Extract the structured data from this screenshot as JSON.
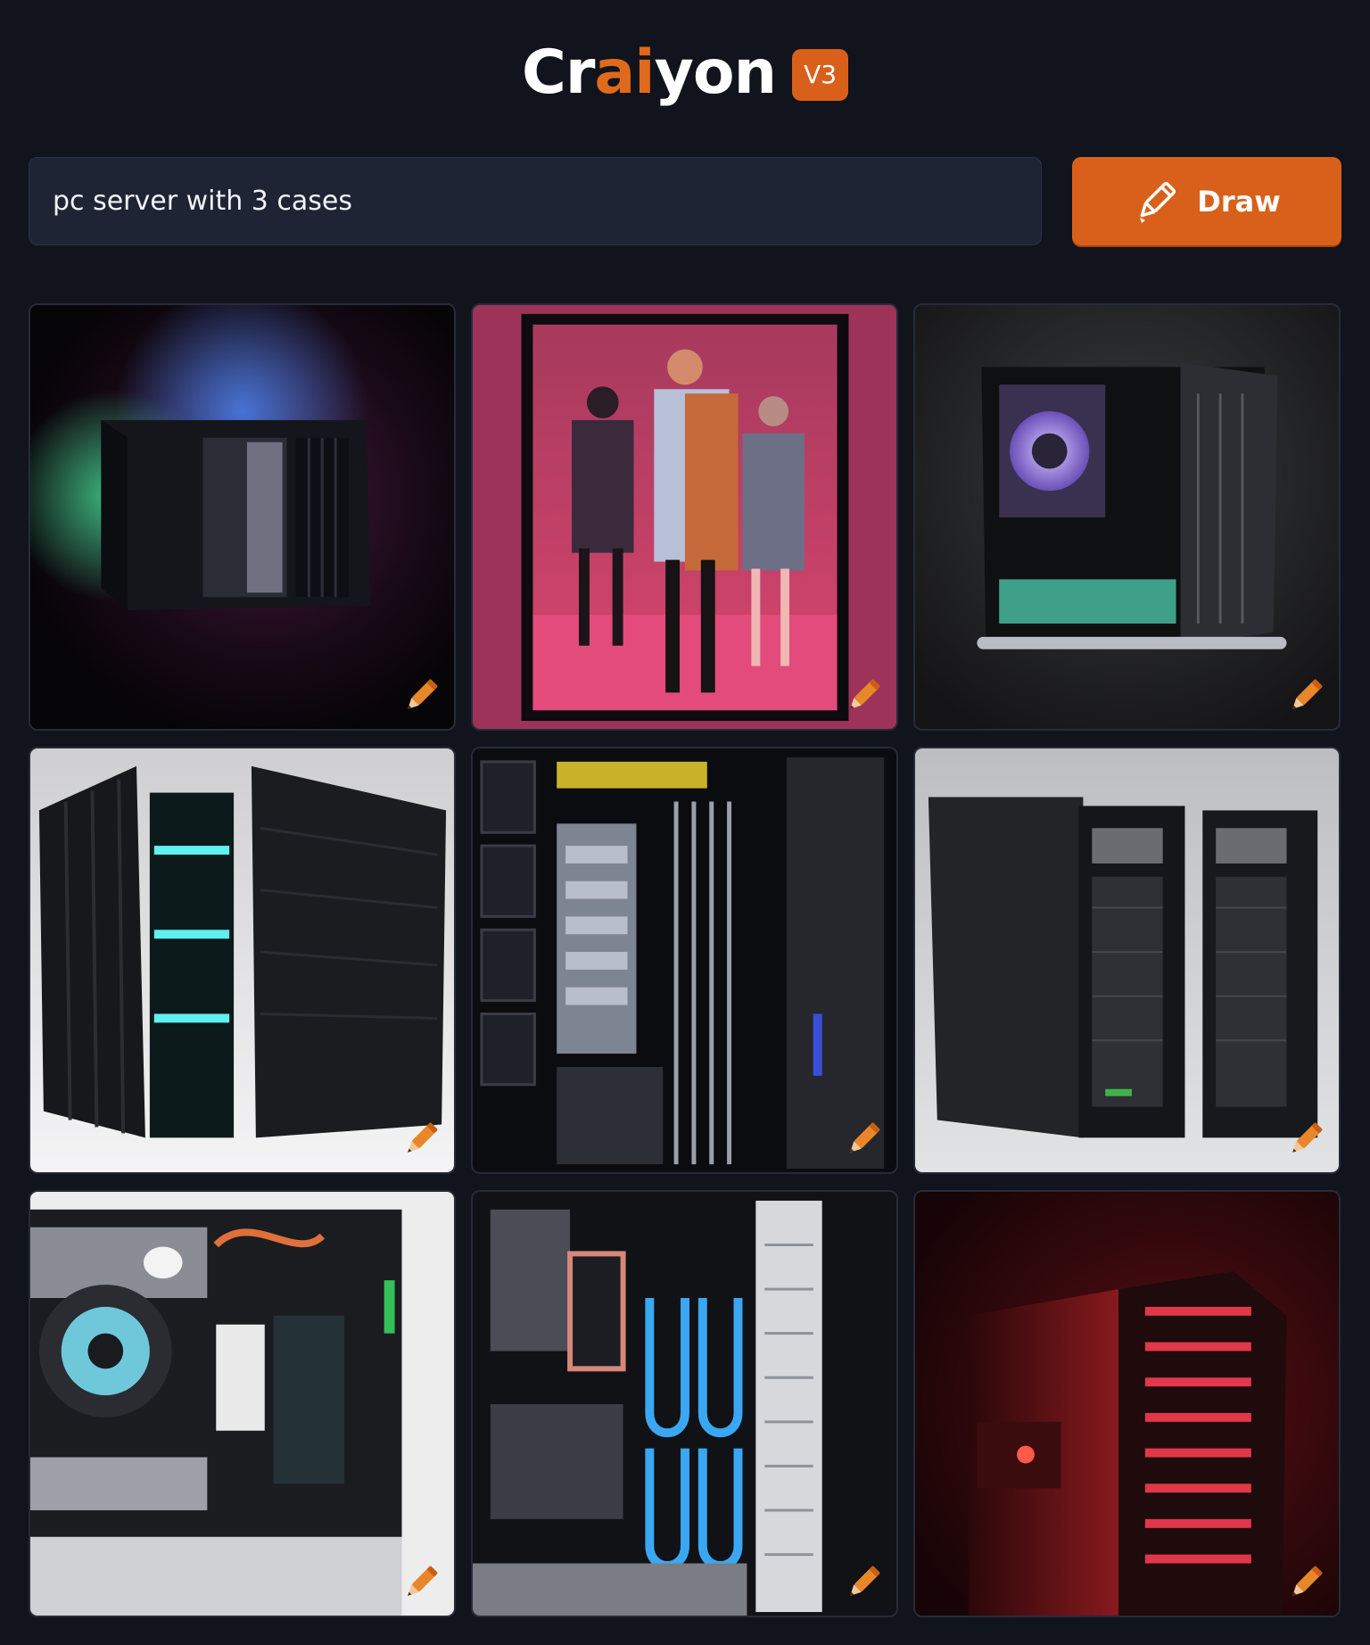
{
  "header": {
    "logo_part1": "Cr",
    "logo_ai1": "a",
    "logo_ai2": "i",
    "logo_part2": "yon",
    "version": "V3"
  },
  "prompt": {
    "value": "pc server with 3 cases"
  },
  "draw_button": {
    "label": "Draw",
    "icon": "pencil-icon"
  },
  "colors": {
    "background": "#11141c",
    "input_bg": "#1f2434",
    "accent": "#d9601a"
  },
  "results": [
    {
      "icon": "edit-icon"
    },
    {
      "icon": "edit-icon"
    },
    {
      "icon": "edit-icon"
    },
    {
      "icon": "edit-icon"
    },
    {
      "icon": "edit-icon"
    },
    {
      "icon": "edit-icon"
    },
    {
      "icon": "edit-icon"
    },
    {
      "icon": "edit-icon"
    },
    {
      "icon": "edit-icon"
    }
  ]
}
